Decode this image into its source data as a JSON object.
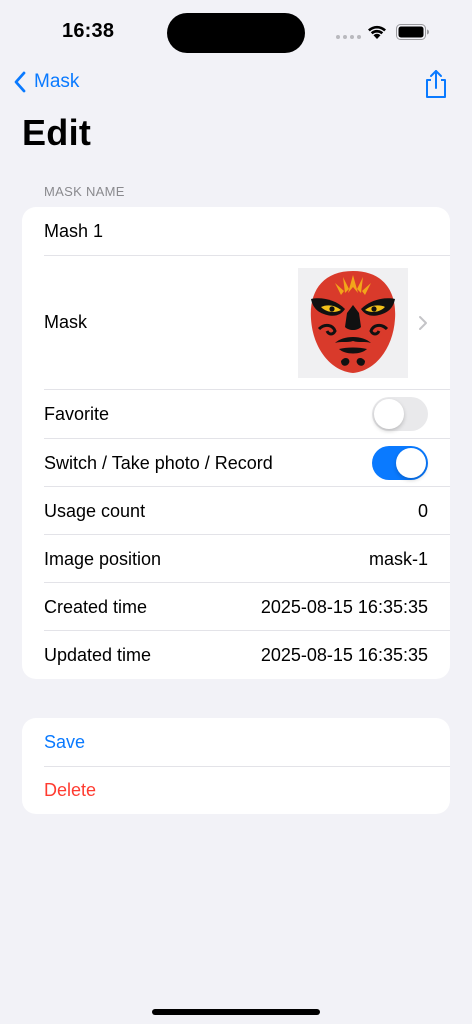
{
  "status_bar": {
    "time": "16:38"
  },
  "nav": {
    "back_label": "Mask",
    "title": "Edit"
  },
  "form": {
    "section_header": "MASK NAME",
    "name_value": "Mash 1",
    "mask_label": "Mask",
    "favorite_label": "Favorite",
    "favorite_on": false,
    "switch_label": "Switch / Take photo / Record",
    "switch_on": true,
    "usage_count_label": "Usage count",
    "usage_count_value": "0",
    "image_position_label": "Image position",
    "image_position_value": "mask-1",
    "created_label": "Created time",
    "created_value": "2025-08-15 16:35:35",
    "updated_label": "Updated time",
    "updated_value": "2025-08-15 16:35:35"
  },
  "actions": {
    "save_label": "Save",
    "delete_label": "Delete"
  },
  "colors": {
    "accent": "#0a7aff",
    "destructive": "#ff3b30",
    "background": "#f2f2f7"
  },
  "icons": {
    "back": "chevron-left-icon",
    "share": "share-icon",
    "disclosure": "chevron-right-icon"
  }
}
